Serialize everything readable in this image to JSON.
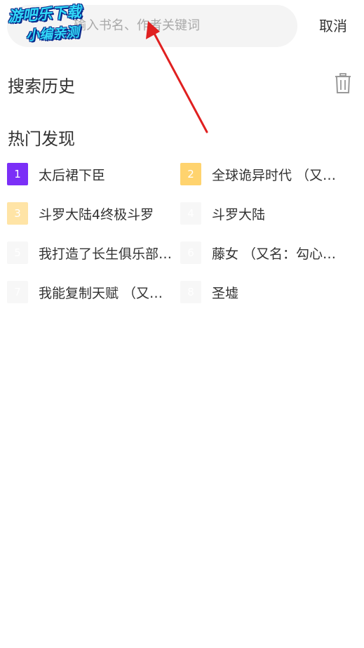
{
  "search": {
    "placeholder": "输入书名、作者关键词",
    "cancel_label": "取消"
  },
  "watermark": {
    "line1": "游吧乐下载",
    "line2": "小编亲测"
  },
  "history": {
    "title": "搜索历史",
    "clear_icon": "trash-icon"
  },
  "hot": {
    "title": "热门发现",
    "items": [
      {
        "rank": "1",
        "title": "太后裙下臣",
        "badge_color": "#7b2ff7"
      },
      {
        "rank": "2",
        "title": "全球诡异时代 （又名：诡异入侵）",
        "badge_color": "#ffd36e"
      },
      {
        "rank": "3",
        "title": "斗罗大陆4终极斗罗",
        "badge_color": "#ffe4a6"
      },
      {
        "rank": "4",
        "title": "斗罗大陆",
        "badge_color": "#f7f7f7"
      },
      {
        "rank": "5",
        "title": "我打造了长生俱乐部（又名）",
        "badge_color": "#f7f7f7"
      },
      {
        "rank": "6",
        "title": "藤女 （又名：勾心斗角）",
        "badge_color": "#f7f7f7"
      },
      {
        "rank": "7",
        "title": "我能复制天赋 （又名：无限）",
        "badge_color": "#f7f7f7"
      },
      {
        "rank": "8",
        "title": "圣墟",
        "badge_color": "#f7f7f7"
      }
    ]
  },
  "annotation": {
    "arrow_color": "#e02020"
  }
}
